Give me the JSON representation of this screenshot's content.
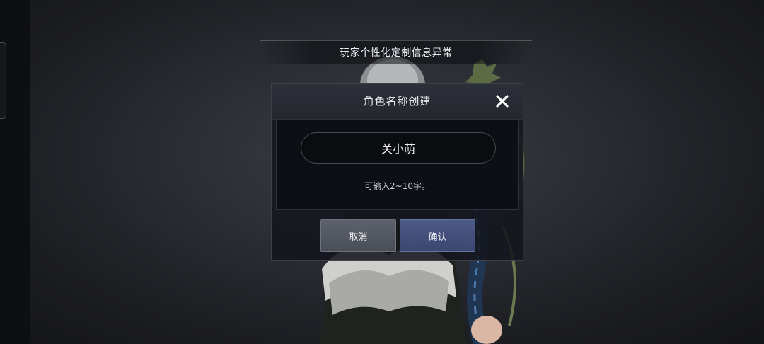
{
  "screen": {
    "banner_text": "玩家个性化定制信息异常"
  },
  "dialog": {
    "title": "角色名称创建",
    "close_icon": "close-icon",
    "name_input": {
      "value": "关小萌",
      "placeholder": ""
    },
    "hint": "可输入2~10字。",
    "cancel_label": "取消",
    "confirm_label": "确认"
  },
  "colors": {
    "confirm_button": "#46527c",
    "cancel_button": "#545862",
    "dialog_background": "#16181e"
  }
}
